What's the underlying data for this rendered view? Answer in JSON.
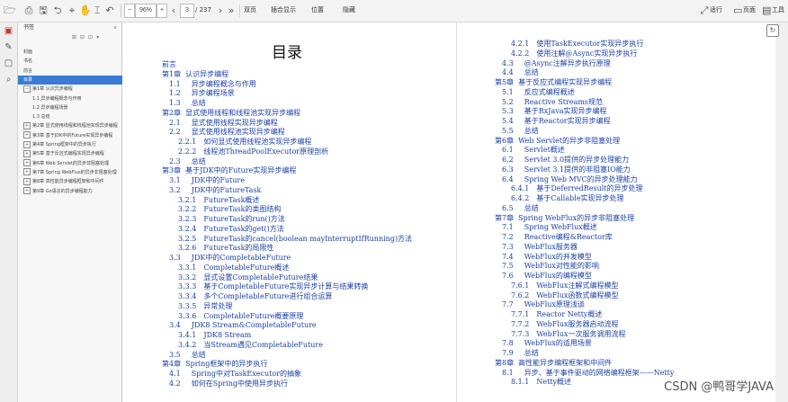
{
  "toolbar": {
    "zoom": "96%",
    "page_current": "3",
    "page_total": "/ 237",
    "tools": [
      "双页",
      "插合显示",
      "位置",
      "隐藏"
    ],
    "right_tools": [
      "适行",
      "页面",
      "工具"
    ],
    "buttons": [
      "−",
      "+"
    ]
  },
  "sidebar": {
    "title": "书签",
    "items": [
      {
        "label": "封面",
        "level": 0,
        "expander": ""
      },
      {
        "label": "书名",
        "level": 0,
        "expander": ""
      },
      {
        "label": "前言",
        "level": 0,
        "expander": ""
      },
      {
        "label": "目录",
        "level": 0,
        "expander": "",
        "selected": true
      },
      {
        "label": "第1章 认识异步编程",
        "level": 0,
        "expander": "−"
      },
      {
        "label": "1.1 异步编程概念与作用",
        "level": 1,
        "expander": ""
      },
      {
        "label": "1.2 异步编程场景",
        "level": 1,
        "expander": ""
      },
      {
        "label": "1.3 总结",
        "level": 1,
        "expander": ""
      },
      {
        "label": "第2章 显式使用线程和线程池实现异步编程",
        "level": 0,
        "expander": "+"
      },
      {
        "label": "第3章 基于JDK中的Future实现异步编程",
        "level": 0,
        "expander": "+"
      },
      {
        "label": "第4章 Spring框架中的异步执行",
        "level": 0,
        "expander": "+"
      },
      {
        "label": "第5章 基于反应式编程实现异步编程",
        "level": 0,
        "expander": "+"
      },
      {
        "label": "第6章 Web Servlet的异步非阻塞处理",
        "level": 0,
        "expander": "+"
      },
      {
        "label": "第7章 Spring WebFlux的异步非阻塞处理",
        "level": 0,
        "expander": "+"
      },
      {
        "label": "第8章 高性能异步编程框架和中间件",
        "level": 0,
        "expander": "+"
      },
      {
        "label": "第9章 Go语言的异步编程能力",
        "level": 0,
        "expander": "+"
      }
    ]
  },
  "left_page": {
    "title": "目录",
    "entries": [
      {
        "num": "前言",
        "text": ""
      },
      {
        "num": "第1章",
        "text": "认识异步编程"
      },
      {
        "num": "1.1",
        "text": "异步编程概念与作用"
      },
      {
        "num": "1.2",
        "text": "异步编程场景"
      },
      {
        "num": "1.3",
        "text": "总结"
      },
      {
        "num": "第2章",
        "text": "显式使用线程和线程池实现异步编程"
      },
      {
        "num": "2.1",
        "text": "显式使用线程实现异步编程"
      },
      {
        "num": "2.2",
        "text": "显式使用线程池实现异步编程"
      },
      {
        "num": "2.2.1",
        "text": "如何显式使用线程池实现异步编程"
      },
      {
        "num": "2.2.2",
        "text": "线程池ThreadPoolExecutor原理剖析"
      },
      {
        "num": "2.3",
        "text": "总结"
      },
      {
        "num": "第3章",
        "text": "基于JDK中的Future实现异步编程"
      },
      {
        "num": "3.1",
        "text": "JDK中的Future"
      },
      {
        "num": "3.2",
        "text": "JDK中的FutureTask"
      },
      {
        "num": "3.2.1",
        "text": "FutureTask概述"
      },
      {
        "num": "3.2.2",
        "text": "FutureTask的类图结构"
      },
      {
        "num": "3.2.3",
        "text": "FutureTask的run()方法"
      },
      {
        "num": "3.2.4",
        "text": "FutureTask的get()方法"
      },
      {
        "num": "3.2.5",
        "text": "FutureTask的cancel(boolean    mayInterruptIfRunning)方法"
      },
      {
        "num": "3.2.6",
        "text": "FutureTask的局限性"
      },
      {
        "num": "3.3",
        "text": "JDK中的CompletableFuture"
      },
      {
        "num": "3.3.1",
        "text": "CompletableFuture概述"
      },
      {
        "num": "3.3.2",
        "text": "显式设置CompletableFuture结果"
      },
      {
        "num": "3.3.3",
        "text": "基于CompletableFuture实现异步计算与结果转换"
      },
      {
        "num": "3.3.4",
        "text": "多个CompletableFuture进行组合运算"
      },
      {
        "num": "3.3.5",
        "text": "异常处理"
      },
      {
        "num": "3.3.6",
        "text": "CompletableFuture概要原理"
      },
      {
        "num": "3.4",
        "text": "JDK8    Stream&CompletableFuture"
      },
      {
        "num": "3.4.1",
        "text": "JDK8    Stream"
      },
      {
        "num": "3.4.2",
        "text": "当Stream遇见CompletableFuture"
      },
      {
        "num": "3.5",
        "text": "总结"
      },
      {
        "num": "第4章",
        "text": "Spring框架中的异步执行"
      },
      {
        "num": "4.1",
        "text": "Spring中对TaskExecutor的抽象"
      },
      {
        "num": "4.2",
        "text": "如何在Spring中使用异步执行"
      }
    ]
  },
  "right_page": {
    "entries": [
      {
        "num": "4.2.1",
        "text": "使用TaskExecutor实现异步执行"
      },
      {
        "num": "4.2.2",
        "text": "使用注解@Async实现异步执行"
      },
      {
        "num": "4.3",
        "text": "@Async注解异步执行原理"
      },
      {
        "num": "4.4",
        "text": "总结"
      },
      {
        "num": "第5章",
        "text": "基于反应式编程实现异步编程"
      },
      {
        "num": "5.1",
        "text": "反应式编程概述"
      },
      {
        "num": "5.2",
        "text": "Reactive    Streams规范"
      },
      {
        "num": "5.3",
        "text": "基于RxJava实现异步编程"
      },
      {
        "num": "5.4",
        "text": "基于Reactor实现异步编程"
      },
      {
        "num": "5.5",
        "text": "总结"
      },
      {
        "num": "第6章",
        "text": "Web    Servlet的异步非阻塞处理"
      },
      {
        "num": "6.1",
        "text": "Servlet概述"
      },
      {
        "num": "6.2",
        "text": "Servlet    3.0提供的异步处理能力"
      },
      {
        "num": "6.3",
        "text": "Servlet    3.1提供的非阻塞IO能力"
      },
      {
        "num": "6.4",
        "text": "Spring    Web    MVC的异步处理能力"
      },
      {
        "num": "6.4.1",
        "text": "基于DeferredResult的异步处理"
      },
      {
        "num": "6.4.2",
        "text": "基于Callable实现异步处理"
      },
      {
        "num": "6.5",
        "text": "总结"
      },
      {
        "num": "第7章",
        "text": "Spring    WebFlux的异步非阻塞处理"
      },
      {
        "num": "7.1",
        "text": "Spring    WebFlux概述"
      },
      {
        "num": "7.2",
        "text": "Reactive编程&Reactor库"
      },
      {
        "num": "7.3",
        "text": "WebFlux服务器"
      },
      {
        "num": "7.4",
        "text": "WebFlux的并发模型"
      },
      {
        "num": "7.5",
        "text": "WebFlux对性能的影响"
      },
      {
        "num": "7.6",
        "text": "WebFlux的编程模型"
      },
      {
        "num": "7.6.1",
        "text": "WebFlux注解式编程模型"
      },
      {
        "num": "7.6.2",
        "text": "WebFlux函数式编程模型"
      },
      {
        "num": "7.7",
        "text": "WebFlux原理浅谈"
      },
      {
        "num": "7.7.1",
        "text": "Reactor    Netty概述"
      },
      {
        "num": "7.7.2",
        "text": "WebFlux服务器启动流程"
      },
      {
        "num": "7.7.3",
        "text": "WebFlux一次服务调用流程"
      },
      {
        "num": "7.8",
        "text": "WebFlux的适用场景"
      },
      {
        "num": "7.9",
        "text": "总结"
      },
      {
        "num": "第8章",
        "text": "高性能异步编程框架和中间件"
      },
      {
        "num": "8.1",
        "text": "异步、基于事件驱动的网络编程框架——Netty"
      },
      {
        "num": "8.1.1",
        "text": "Netty概述"
      }
    ]
  },
  "watermark": "CSDN @鸭哥学JAVA"
}
